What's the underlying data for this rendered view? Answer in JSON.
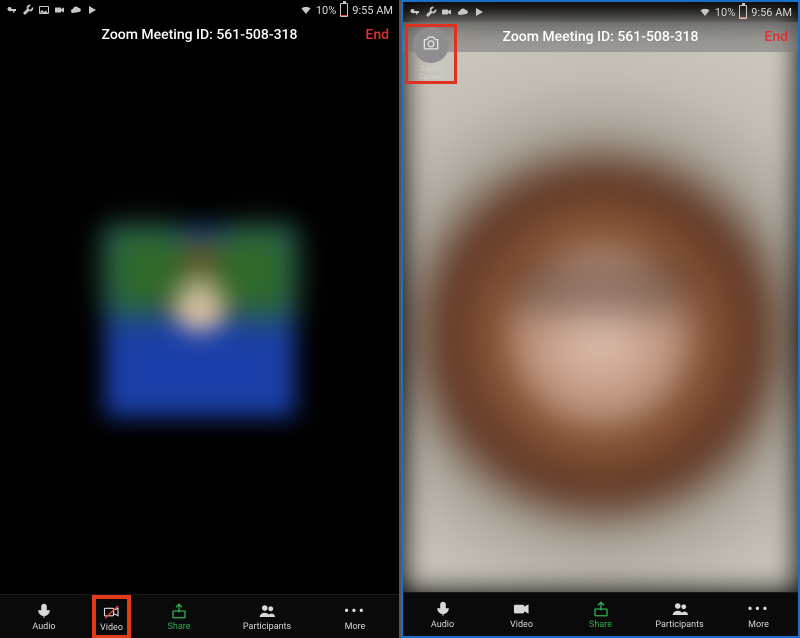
{
  "left": {
    "status": {
      "battery_pct": "10%",
      "time": "9:55 AM"
    },
    "header": {
      "title": "Zoom Meeting ID: 561-508-318",
      "end": "End"
    },
    "toolbar": {
      "audio": "Audio",
      "video": "Video",
      "share": "Share",
      "participants": "Participants",
      "more": "More"
    }
  },
  "right": {
    "status": {
      "battery_pct": "10%",
      "time": "9:56 AM"
    },
    "header": {
      "title": "Zoom Meeting ID: 561-508-318",
      "end": "End"
    },
    "switch_camera": {
      "label": "Switch Camera"
    },
    "toolbar": {
      "audio": "Audio",
      "video": "Video",
      "share": "Share",
      "participants": "Participants",
      "more": "More"
    }
  },
  "colors": {
    "accent_green": "#2fae4e",
    "danger": "#e03020",
    "highlight": "#e23b1c"
  }
}
